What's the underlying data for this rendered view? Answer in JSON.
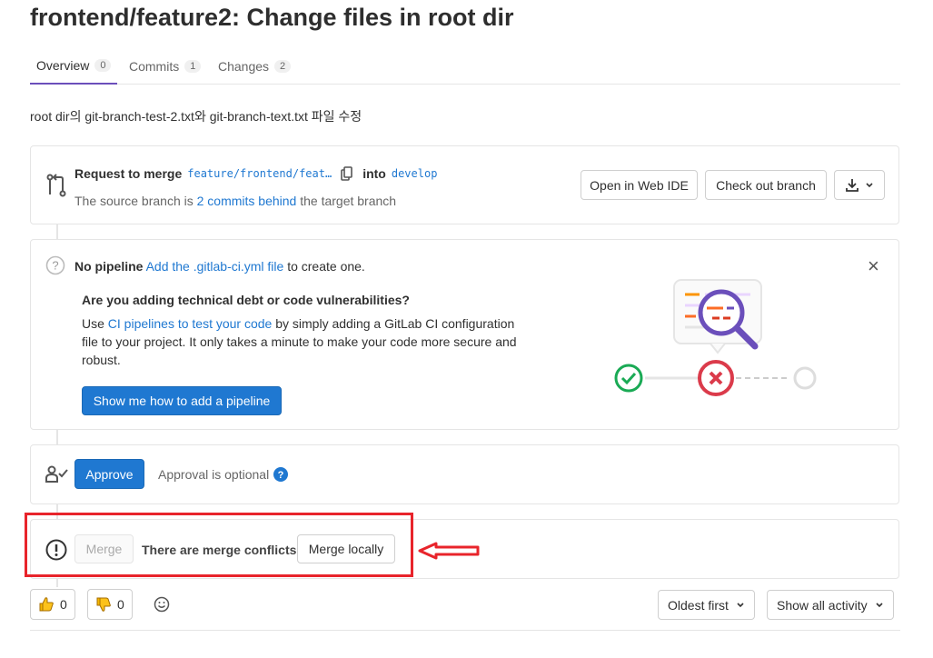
{
  "header": {
    "title": "frontend/feature2: Change files in root dir"
  },
  "tabs": [
    {
      "label": "Overview",
      "count": "0"
    },
    {
      "label": "Commits",
      "count": "1"
    },
    {
      "label": "Changes",
      "count": "2"
    }
  ],
  "description": "root dir의 git-branch-test-2.txt와 git-branch-text.txt 파일 수정",
  "merge_request": {
    "request_label": "Request to merge",
    "source_branch": "feature/frontend/feat…",
    "into_label": "into",
    "target_branch": "develop",
    "behind_prefix": "The source branch is",
    "behind_link": "2 commits behind",
    "behind_suffix": "the target branch",
    "open_web_ide": "Open in Web IDE",
    "check_out_branch": "Check out branch"
  },
  "pipeline": {
    "status_label": "No pipeline",
    "add_link": "Add the .gitlab-ci.yml file",
    "add_suffix": "to create one.",
    "heading": "Are you adding technical debt or code vulnerabilities?",
    "body_prefix": "Use",
    "body_link": "CI pipelines to test your code",
    "body_line1_suffix": "by simply adding a GitLab CI configuration",
    "body_line2": "file to your project. It only takes a minute to make your code more secure and",
    "body_line3": "robust.",
    "cta": "Show me how to add a pipeline"
  },
  "approval": {
    "approve_label": "Approve",
    "optional_text": "Approval is optional"
  },
  "merge": {
    "merge_label": "Merge",
    "conflict_text": "There are merge conflicts",
    "merge_locally": "Merge locally"
  },
  "reactions": {
    "thumbs_up_count": "0",
    "thumbs_down_count": "0"
  },
  "activity": {
    "sort_label": "Oldest first",
    "filter_label": "Show all activity"
  },
  "colors": {
    "accent": "#1f78d1",
    "tab_active": "#6b4fbb",
    "annotation": "#e8242b"
  }
}
